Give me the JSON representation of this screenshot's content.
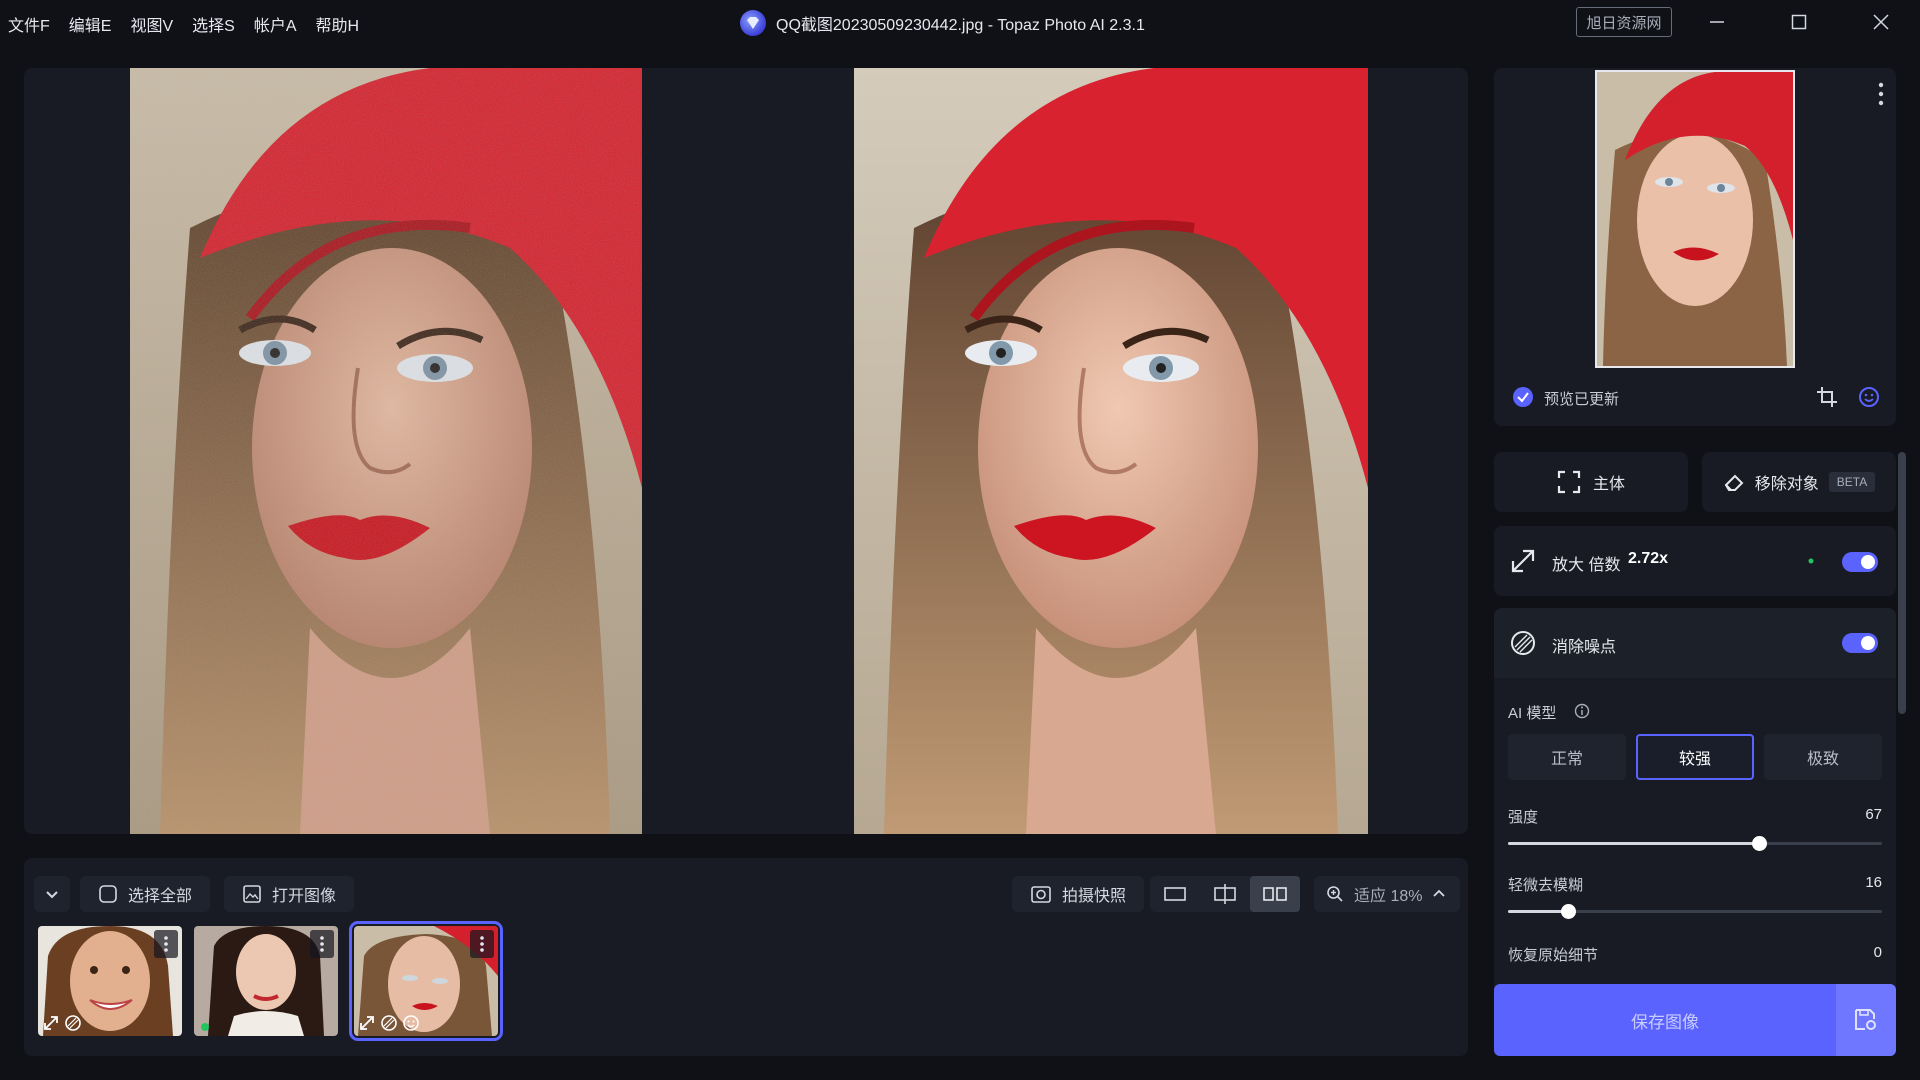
{
  "menu": [
    "文件F",
    "编辑E",
    "视图V",
    "选择S",
    "帐户A",
    "帮助H"
  ],
  "window_title": "QQ截图20230509230442.jpg - Topaz Photo AI 2.3.1",
  "site_badge": "旭日资源网",
  "preview": {
    "status": "预览已更新"
  },
  "tools": {
    "subject": "主体",
    "remove_object": "移除对象",
    "beta": "BETA"
  },
  "upscale": {
    "label": "放大 倍数",
    "factor": "2.72x",
    "enabled": true
  },
  "denoise": {
    "label": "消除噪点",
    "enabled": true,
    "ai_model_label": "AI 模型",
    "models": [
      "正常",
      "较强",
      "极致"
    ],
    "selected_model": "较强",
    "sliders": [
      {
        "label": "强度",
        "value": "67",
        "fraction": 0.67
      },
      {
        "label": "轻微去模糊",
        "value": "16",
        "fraction": 0.16
      },
      {
        "label": "恢复原始细节",
        "value": "0",
        "fraction": 0.0
      }
    ]
  },
  "save_button": "保存图像",
  "filmstrip": {
    "select_all": "选择全部",
    "open_image": "打开图像",
    "snapshot": "拍摄快照",
    "zoom": "适应 18%"
  },
  "colors": {
    "accent": "#5b63ff",
    "panel": "#181b24",
    "background": "#0f1117"
  }
}
